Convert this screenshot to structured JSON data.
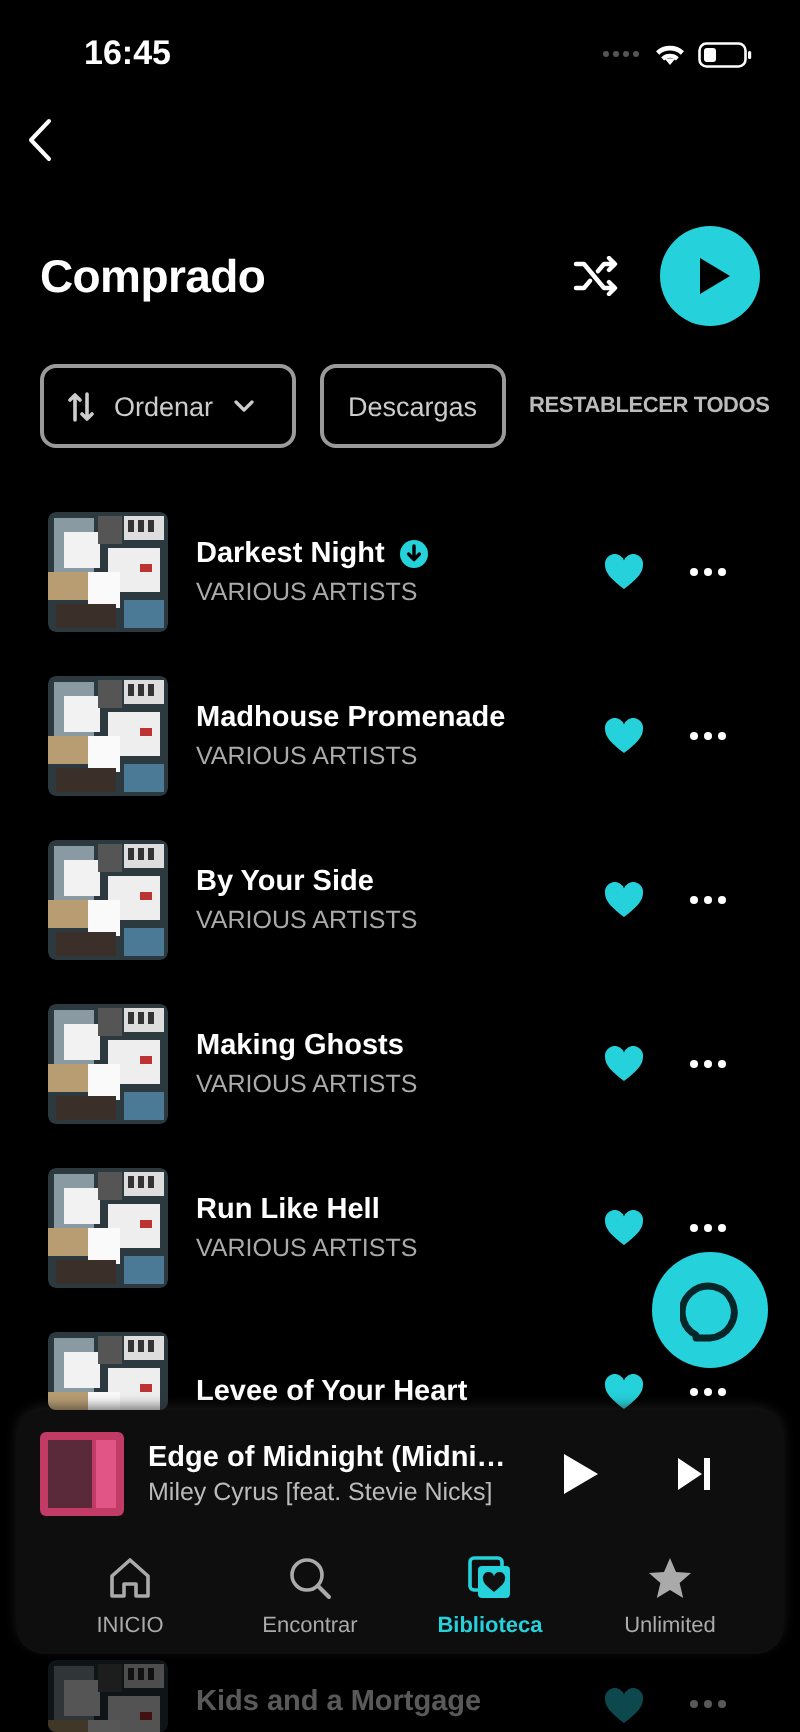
{
  "status_bar": {
    "time": "16:45"
  },
  "header": {
    "title": "Comprado"
  },
  "filters": [
    {
      "kind": "sort",
      "label": "Ordenar"
    },
    {
      "kind": "chip",
      "label": "Descargas"
    },
    {
      "kind": "link",
      "label": "RESTABLECER TODOS"
    }
  ],
  "tracks": [
    {
      "title": "Darkest Night",
      "artist": "VARIOUS ARTISTS",
      "downloaded": true,
      "liked": true
    },
    {
      "title": "Madhouse Promenade",
      "artist": "VARIOUS ARTISTS",
      "downloaded": false,
      "liked": true
    },
    {
      "title": "By Your Side",
      "artist": "VARIOUS ARTISTS",
      "downloaded": false,
      "liked": true
    },
    {
      "title": "Making Ghosts",
      "artist": "VARIOUS ARTISTS",
      "downloaded": false,
      "liked": true
    },
    {
      "title": "Run Like Hell",
      "artist": "VARIOUS ARTISTS",
      "downloaded": false,
      "liked": true
    },
    {
      "title": "Levee of Your Heart",
      "downloaded": false,
      "liked": true
    },
    {
      "title": "Kids and a Mortgage",
      "downloaded": false,
      "liked": true
    }
  ],
  "now_playing": {
    "title": "Edge of Midnight (Midni…",
    "artist": "Miley Cyrus [feat. Stevie Nicks]"
  },
  "nav": [
    {
      "kind": "home",
      "label": "INICIO",
      "selected": false
    },
    {
      "kind": "search",
      "label": "Encontrar",
      "selected": false
    },
    {
      "kind": "library",
      "label": "Biblioteca",
      "selected": true
    },
    {
      "kind": "star",
      "label": "Unlimited",
      "selected": false
    }
  ]
}
